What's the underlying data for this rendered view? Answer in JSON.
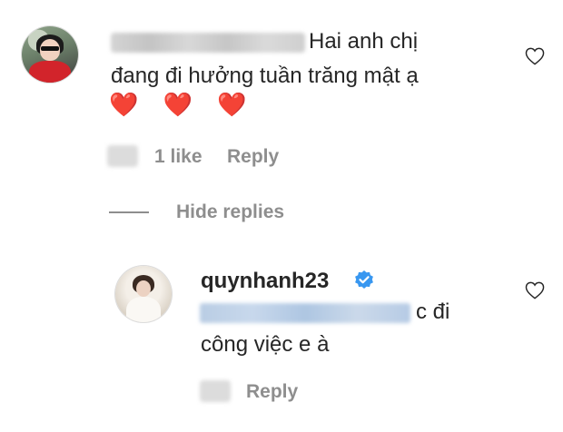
{
  "comment": {
    "text_line1": "Hai anh chị",
    "text_line2": "đang đi hưởng tuần trăng mật ạ",
    "emoji": "❤️ ❤️ ❤️",
    "likes": "1 like",
    "reply_label": "Reply"
  },
  "replies_toggle": {
    "label": "Hide replies"
  },
  "reply": {
    "username": "quynhanh23",
    "text_line1_suffix": "c đi",
    "text_line2": "công việc e à",
    "reply_label": "Reply"
  },
  "colors": {
    "text": "#262626",
    "meta": "#8e8e8e",
    "heart": "#e0282e",
    "verified": "#3897f0"
  }
}
